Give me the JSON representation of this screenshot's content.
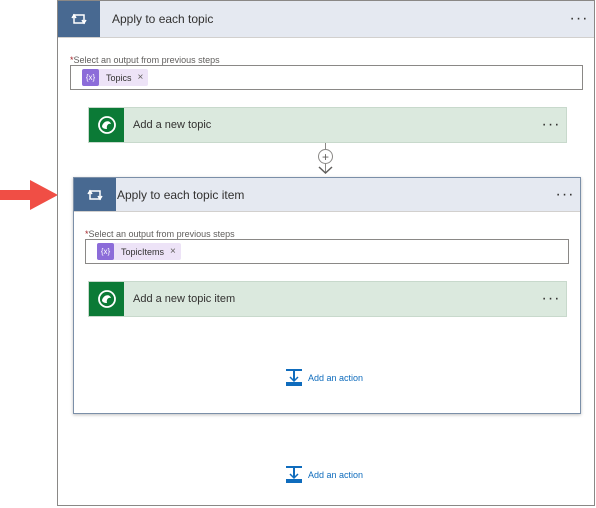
{
  "outer_loop": {
    "title": "Apply to each topic",
    "more_label": "···",
    "select_required_mark": "*",
    "select_label": "Select an output from previous steps",
    "token_label": "Topics",
    "token_close": "×",
    "token_icon": "{x}",
    "action": {
      "title": "Add a new topic",
      "more_label": "···"
    },
    "add_button": "+",
    "add_action_label": "Add an action"
  },
  "inner_loop": {
    "title": "Apply to each topic item",
    "more_label": "···",
    "select_required_mark": "*",
    "select_label": "Select an output from previous steps",
    "token_label": "TopicItems",
    "token_close": "×",
    "token_icon": "{x}",
    "action": {
      "title": "Add a new topic item",
      "more_label": "···"
    },
    "add_action_label": "Add an action"
  },
  "colors": {
    "loop_header_icon": "#486991",
    "loop_header_bg": "#e5e9f1",
    "dataverse_icon": "#0b7a36",
    "action_bg": "#dbe9de",
    "token_icon": "#8c6cd9",
    "link": "#0f6cbd",
    "arrow": "#f04e45"
  },
  "icons": [
    "loop-icon",
    "dataverse-icon",
    "variable-token-icon",
    "add-action-icon",
    "red-pointer-arrow-icon"
  ]
}
